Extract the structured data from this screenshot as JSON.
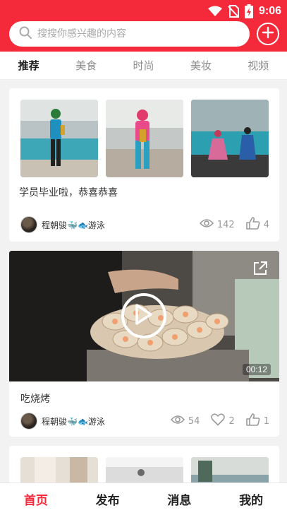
{
  "status_bar": {
    "time": "9:06"
  },
  "search": {
    "placeholder": "搜搜你感兴趣的内容"
  },
  "tabs": [
    {
      "label": "推荐",
      "active": true
    },
    {
      "label": "美食",
      "active": false
    },
    {
      "label": "时尚",
      "active": false
    },
    {
      "label": "美妆",
      "active": false
    },
    {
      "label": "视频",
      "active": false
    }
  ],
  "feed": [
    {
      "caption": "学员毕业啦，恭喜恭喜",
      "author": "程朝骏🐳🐟游泳",
      "views": "142",
      "likes": "4"
    },
    {
      "caption": "吃烧烤",
      "author": "程朝骏🐳🐟游泳",
      "duration": "00:12",
      "views": "54",
      "favorites": "2",
      "likes": "1"
    }
  ],
  "bottom_nav": [
    {
      "label": "首页",
      "active": true
    },
    {
      "label": "发布",
      "active": false
    },
    {
      "label": "消息",
      "active": false
    },
    {
      "label": "我的",
      "active": false
    }
  ],
  "colors": {
    "brand": "#f42a3a",
    "muted": "#9a9a9a"
  },
  "icons": [
    "wifi-icon",
    "no-sim-icon",
    "battery-charging-icon",
    "search-icon",
    "add-icon",
    "eye-icon",
    "thumbs-up-icon",
    "heart-icon",
    "play-icon",
    "share-icon"
  ]
}
